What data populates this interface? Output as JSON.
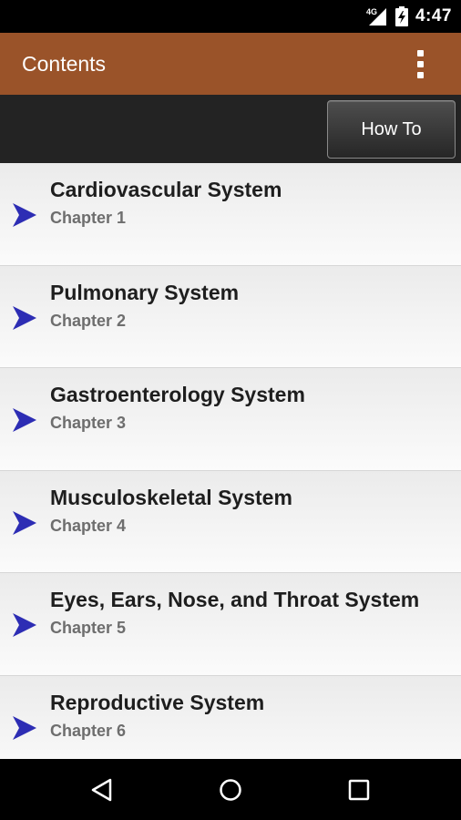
{
  "status_bar": {
    "network": "4G",
    "time": "4:47"
  },
  "app_bar": {
    "title": "Contents"
  },
  "toolbar": {
    "howto_label": "How To"
  },
  "chapters": [
    {
      "title": "Cardiovascular System",
      "subtitle": "Chapter 1"
    },
    {
      "title": "Pulmonary System",
      "subtitle": "Chapter 2"
    },
    {
      "title": "Gastroenterology System",
      "subtitle": "Chapter 3"
    },
    {
      "title": "Musculoskeletal System",
      "subtitle": "Chapter 4"
    },
    {
      "title": "Eyes, Ears, Nose, and Throat System",
      "subtitle": "Chapter 5"
    },
    {
      "title": "Reproductive System",
      "subtitle": "Chapter 6"
    }
  ],
  "icons": {
    "signal": "cell-signal-icon",
    "battery": "battery-charging-icon",
    "overflow": "overflow-menu-icon",
    "list_arrow": "chevron-right-arrow-icon",
    "back": "back-icon",
    "home": "home-icon",
    "recents": "recents-icon"
  },
  "colors": {
    "app_bar": "#9a5329",
    "toolbar": "#232323",
    "arrow": "#2d2db4"
  }
}
